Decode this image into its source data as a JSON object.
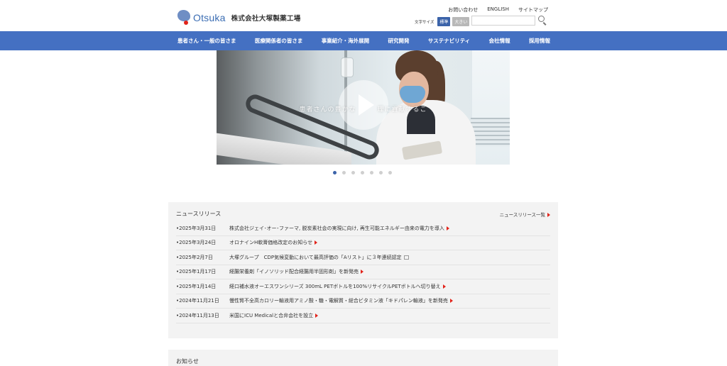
{
  "header": {
    "logo_word": "Otsuka",
    "company_name": "株式会社大塚製薬工場",
    "util_links": [
      "お問い合わせ",
      "ENGLISH",
      "サイトマップ"
    ],
    "fontsize_label": "文字サイズ",
    "fontsize_normal": "標準",
    "fontsize_large": "大きい",
    "search_placeholder": ""
  },
  "nav": {
    "items": [
      "患者さん・一般の皆さま",
      "医療関係者の皆さま",
      "事業紹介・海外展開",
      "研究開発",
      "サステナビリティ",
      "会社情報",
      "採用情報"
    ]
  },
  "hero": {
    "caption": "患者さんの豊かな　　　理に貢献するこ",
    "slide_count": 7,
    "active_slide": 1
  },
  "news": {
    "title": "ニュースリリース",
    "all_link": "ニュースリリース一覧",
    "items": [
      {
        "date": "•2025年3月31日",
        "text": "株式会社ジェイ･オー･ファーマ, 脱炭素社会の実現に向け, 再生可能エネルギー由来の電力を導入",
        "external": false
      },
      {
        "date": "•2025年3月24日",
        "text": "オロナインH軟膏価格改定のお知らせ",
        "external": false
      },
      {
        "date": "•2025年2月7日",
        "text": "大塚グループ　CDP気候変動において最高評価の「Aリスト」に３年連続認定",
        "external": true
      },
      {
        "date": "•2025年1月17日",
        "text": "経腸栄養剤「イノソリッド配合経腸用半固形剤」を新発売",
        "external": false
      },
      {
        "date": "•2025年1月14日",
        "text": "経口補水液オーエスワンシリーズ 300mL PETボトルを100%リサイクルPETボトルへ切り替え",
        "external": false
      },
      {
        "date": "•2024年11月21日",
        "text": "慢性腎不全高カロリー輸液用アミノ酸・糖・電解質・総合ビタミン液「キドパレン輸液」を新発売",
        "external": false
      },
      {
        "date": "•2024年11月13日",
        "text": "米国にICU Medicalと合弁会社を設立",
        "external": false
      }
    ]
  },
  "notice": {
    "title": "お知らせ"
  },
  "colors": {
    "nav_bg": "#4470c2",
    "accent_red": "#e2231a",
    "brand_blue": "#3b6db3"
  }
}
